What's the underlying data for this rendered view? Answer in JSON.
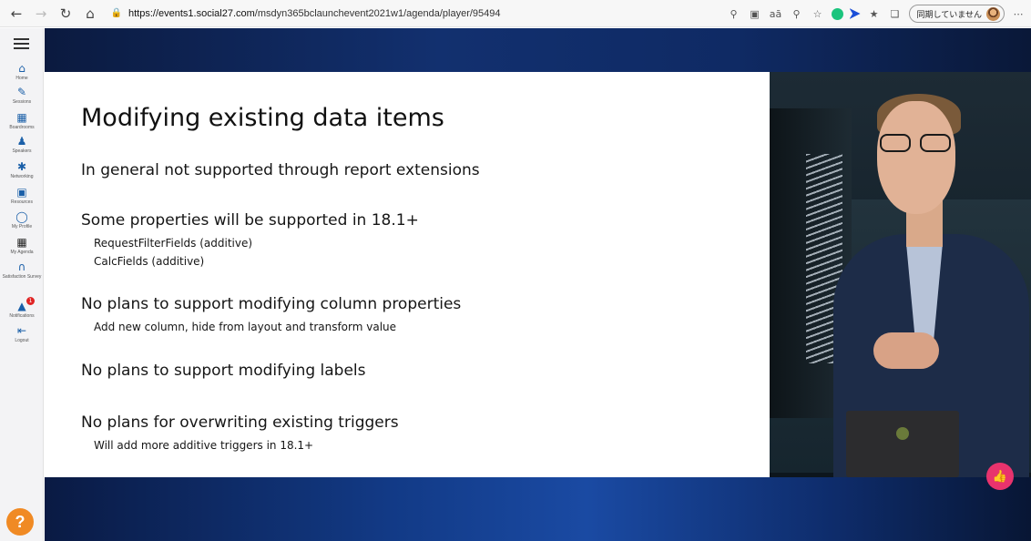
{
  "browser": {
    "url_host": "https://events1.social27.com",
    "url_path": "/msdyn365bclaunchevent2021w1/agenda/player/95494",
    "sync_label": "同期していません"
  },
  "sidebar": {
    "items": [
      {
        "label": "Home",
        "icon": "home-icon"
      },
      {
        "label": "Sessions",
        "icon": "pen-icon"
      },
      {
        "label": "Boardrooms",
        "icon": "boardroom-icon"
      },
      {
        "label": "Speakers",
        "icon": "speaker-icon"
      },
      {
        "label": "Networking",
        "icon": "networking-icon"
      },
      {
        "label": "Resources",
        "icon": "resources-icon"
      },
      {
        "label": "My Profile",
        "icon": "profile-icon"
      },
      {
        "label": "My Agenda",
        "icon": "calendar-icon"
      },
      {
        "label": "Satisfaction Survey",
        "icon": "survey-icon"
      },
      {
        "label": "Notifications",
        "icon": "bell-icon",
        "badge": "1"
      },
      {
        "label": "Logout",
        "icon": "logout-icon"
      }
    ],
    "help_label": "?"
  },
  "slide": {
    "title": "Modifying existing data items",
    "lines": [
      {
        "text": "In general not supported through report extensions",
        "level": 1
      },
      {
        "text": "Some properties will be supported in 18.1+",
        "level": 1
      },
      {
        "text": "RequestFilterFields (additive)",
        "level": 2
      },
      {
        "text": "CalcFields (additive)",
        "level": 2
      },
      {
        "text": "No plans to support modifying column properties",
        "level": 1
      },
      {
        "text": "Add new column, hide from layout and transform value",
        "level": 2
      },
      {
        "text": "No plans to support modifying labels",
        "level": 1
      },
      {
        "text": "No plans for overwriting existing triggers",
        "level": 1
      },
      {
        "text": "Will add more additive triggers in 18.1+",
        "level": 2
      }
    ]
  },
  "colors": {
    "sidebar_icon": "#1a5fa8",
    "help_button": "#f08a24",
    "like_button": "#e8336d",
    "player_band": "#123a86"
  }
}
